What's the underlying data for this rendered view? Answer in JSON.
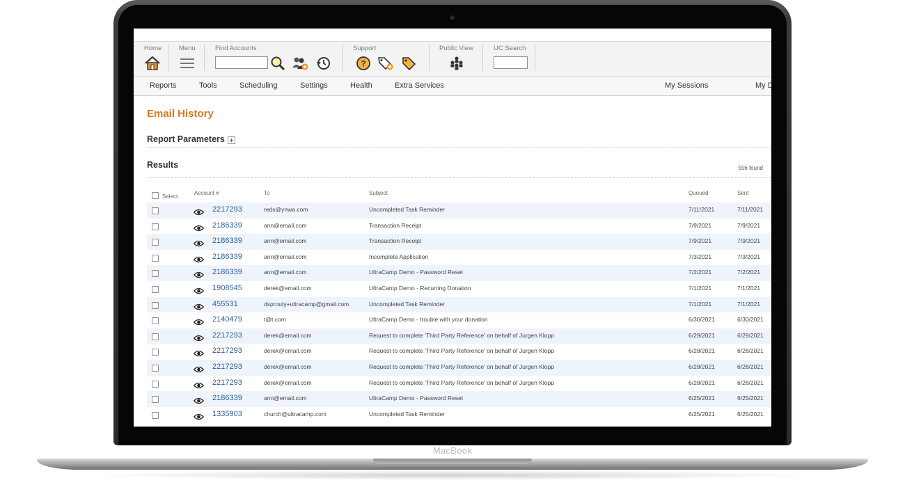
{
  "device": {
    "brand_label": "MacBook"
  },
  "toolbar": {
    "home_label": "Home",
    "menu_label": "Menu",
    "find_accounts_label": "Find Accounts",
    "find_accounts_value": "",
    "support_label": "Support",
    "public_view_label": "Public View",
    "uc_search_label": "UC Search",
    "uc_search_value": ""
  },
  "nav": {
    "items": [
      "Reports",
      "Tools",
      "Scheduling",
      "Settings",
      "Health",
      "Extra Services"
    ],
    "right": [
      "My Sessions",
      "My D"
    ]
  },
  "page": {
    "title": "Email History",
    "report_parameters_label": "Report Parameters",
    "results_label": "Results",
    "found_count": "556 found"
  },
  "table": {
    "columns": [
      "Select",
      "Account #",
      "To",
      "Subject",
      "Queued",
      "Sent"
    ],
    "rows": [
      {
        "account": "2217293",
        "to": "reds@ynwa.com",
        "subject": "Uncompleted Task Reminder",
        "queued": "7/11/2021",
        "sent": "7/11/2021"
      },
      {
        "account": "2186339",
        "to": "ann@email.com",
        "subject": "Transaction Receipt",
        "queued": "7/9/2021",
        "sent": "7/9/2021"
      },
      {
        "account": "2186339",
        "to": "ann@email.com",
        "subject": "Transaction Receipt",
        "queued": "7/9/2021",
        "sent": "7/9/2021"
      },
      {
        "account": "2186339",
        "to": "ann@email.com",
        "subject": "Incomplete Application",
        "queued": "7/3/2021",
        "sent": "7/3/2021"
      },
      {
        "account": "2186339",
        "to": "ann@email.com",
        "subject": "UltraCamp Demo - Password Reset",
        "queued": "7/2/2021",
        "sent": "7/2/2021"
      },
      {
        "account": "1908545",
        "to": "derek@email.com",
        "subject": "UltraCamp Demo - Recurring Donation",
        "queued": "7/1/2021",
        "sent": "7/1/2021"
      },
      {
        "account": "455531",
        "to": "dsprouty+ultracamp@gmail.com",
        "subject": "Uncompleted Task Reminder",
        "queued": "7/1/2021",
        "sent": "7/1/2021"
      },
      {
        "account": "2140479",
        "to": "t@t.com",
        "subject": "UltraCamp Demo - trouble with your donation",
        "queued": "6/30/2021",
        "sent": "6/30/2021"
      },
      {
        "account": "2217293",
        "to": "derek@email.com",
        "subject": "Request to complete 'Third Party Reference' on behalf of Jurgen Klopp",
        "queued": "6/29/2021",
        "sent": "6/29/2021"
      },
      {
        "account": "2217293",
        "to": "derek@email.com",
        "subject": "Request to complete 'Third Party Reference' on behalf of Jurgen Klopp",
        "queued": "6/28/2021",
        "sent": "6/28/2021"
      },
      {
        "account": "2217293",
        "to": "derek@email.com",
        "subject": "Request to complete 'Third Party Reference' on behalf of Jurgen Klopp",
        "queued": "6/28/2021",
        "sent": "6/28/2021"
      },
      {
        "account": "2217293",
        "to": "derek@email.com",
        "subject": "Request to complete 'Third Party Reference' on behalf of Jurgen Klopp",
        "queued": "6/28/2021",
        "sent": "6/28/2021"
      },
      {
        "account": "2186339",
        "to": "ann@email.com",
        "subject": "UltraCamp Demo - Password Reset",
        "queued": "6/25/2021",
        "sent": "6/25/2021"
      },
      {
        "account": "1335903",
        "to": "church@ultracamp.com",
        "subject": "Uncompleted Task Reminder",
        "queued": "6/25/2021",
        "sent": "6/25/2021"
      }
    ]
  },
  "colors": {
    "accent": "#d47a1f",
    "link": "#2d5f9a",
    "row_alt": "#eef4fa"
  }
}
